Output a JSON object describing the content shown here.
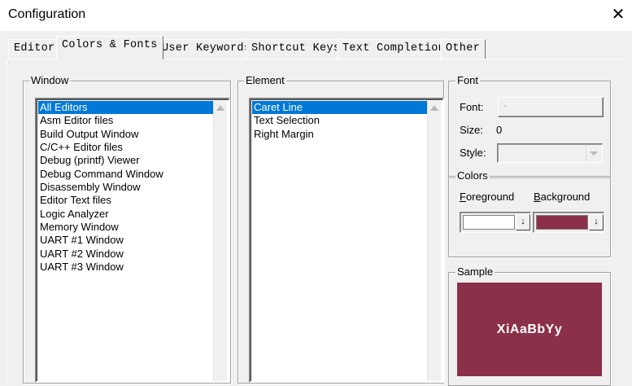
{
  "window": {
    "title": "Configuration"
  },
  "tabs": [
    {
      "label": "Editor"
    },
    {
      "label": "Colors & Fonts"
    },
    {
      "label": "User Keywords"
    },
    {
      "label": "Shortcut Keys"
    },
    {
      "label": "Text Completion"
    },
    {
      "label": "Other"
    }
  ],
  "active_tab": "Colors & Fonts",
  "window_group": {
    "label": "Window",
    "items": [
      "All Editors",
      "Asm Editor files",
      "Build Output Window",
      "C/C++ Editor files",
      "Debug (printf) Viewer",
      "Debug Command Window",
      "Disassembly Window",
      "Editor Text files",
      "Logic Analyzer",
      "Memory Window",
      "UART #1 Window",
      "UART #2 Window",
      "UART #3 Window"
    ],
    "selected": "All Editors"
  },
  "element_group": {
    "label": "Element",
    "items": [
      "Caret Line",
      "Text Selection",
      "Right Margin"
    ],
    "selected": "Caret Line"
  },
  "font_group": {
    "label": "Font",
    "font_label": "Font:",
    "font_button_value": "-",
    "size_label": "Size:",
    "size_value": "0",
    "style_label": "Style:",
    "style_value": ""
  },
  "colors_group": {
    "label": "Colors",
    "foreground_label_ul": "F",
    "foreground_label_rest": "oreground",
    "background_label_ul": "B",
    "background_label_rest": "ackground",
    "foreground_color": "#ffffff",
    "background_color": "#8b3049",
    "dropdown_glyph": "↓"
  },
  "sample_group": {
    "label": "Sample",
    "sample_text": "XiAaBbYy",
    "sample_bg": "#8b3049",
    "sample_fg": "#ffffff"
  }
}
